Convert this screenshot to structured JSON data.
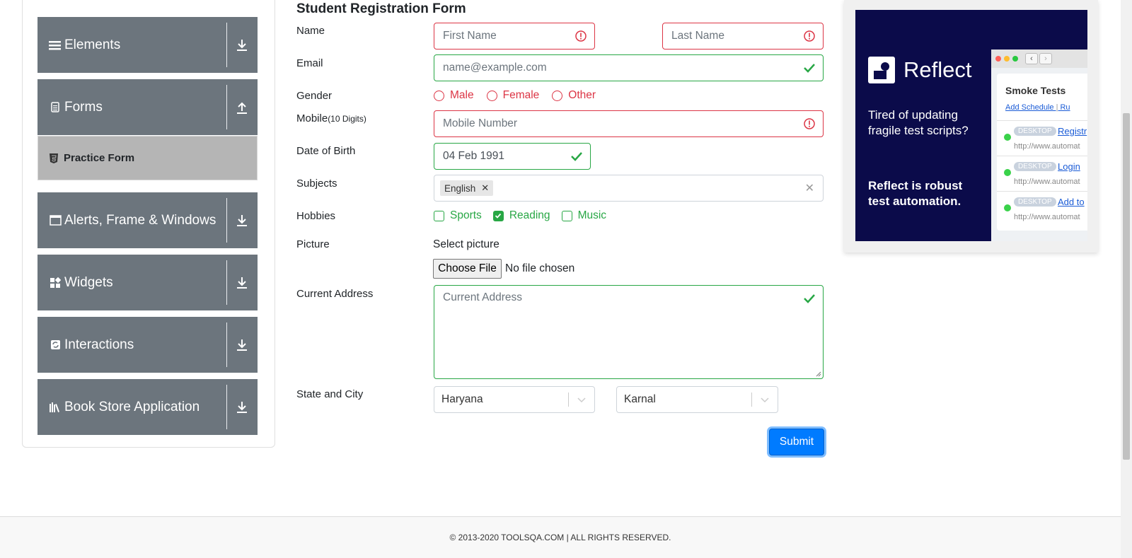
{
  "sidebar": {
    "groups": [
      {
        "label": "Elements",
        "icon": "hamburger-icon",
        "arrow": "download-icon"
      },
      {
        "label": "Forms",
        "icon": "document-icon",
        "arrow": "upload-icon"
      },
      {
        "label": "Alerts, Frame & Windows",
        "icon": "window-icon",
        "arrow": "download-icon"
      },
      {
        "label": "Widgets",
        "icon": "widgets-icon",
        "arrow": "download-icon"
      },
      {
        "label": "Interactions",
        "icon": "refresh-icon",
        "arrow": "download-icon"
      },
      {
        "label": "Book Store Application",
        "icon": "books-icon",
        "arrow": "download-icon"
      }
    ],
    "active_item": "Practice Form"
  },
  "form": {
    "title": "Student Registration Form",
    "labels": {
      "name": "Name",
      "email": "Email",
      "gender": "Gender",
      "mobile": "Mobile",
      "mobile_hint": "(10 Digits)",
      "dob": "Date of Birth",
      "subjects": "Subjects",
      "hobbies": "Hobbies",
      "picture": "Picture",
      "address": "Current Address",
      "state_city": "State and City"
    },
    "first_name": {
      "placeholder": "First Name",
      "value": ""
    },
    "last_name": {
      "placeholder": "Last Name",
      "value": ""
    },
    "email": {
      "placeholder": "name@example.com",
      "value": ""
    },
    "gender_options": [
      "Male",
      "Female",
      "Other"
    ],
    "mobile": {
      "placeholder": "Mobile Number",
      "value": ""
    },
    "dob": {
      "value": "04 Feb 1991"
    },
    "subjects": [
      "English"
    ],
    "hobbies": [
      {
        "label": "Sports",
        "checked": false
      },
      {
        "label": "Reading",
        "checked": true
      },
      {
        "label": "Music",
        "checked": false
      }
    ],
    "picture_label": "Select picture",
    "file_button": "Choose File",
    "file_status": "No file chosen",
    "address": {
      "placeholder": "Current Address",
      "value": ""
    },
    "state": "Haryana",
    "city": "Karnal",
    "submit": "Submit"
  },
  "ad": {
    "brand": "Reflect",
    "tagline1": "Tired of updating fragile test scripts?",
    "tagline2": "Reflect is robust test automation.",
    "panel_title": "Smoke Tests",
    "schedule_link": "Add Schedule",
    "run_link": "Ru",
    "rows": [
      {
        "tag": "DESKTOP",
        "link": "Registr",
        "url": "http://www.automat"
      },
      {
        "tag": "DESKTOP",
        "link": "Login",
        "url": "http://www.automat"
      },
      {
        "tag": "DESKTOP",
        "link": "Add to",
        "url": "http://www.automat"
      }
    ]
  },
  "footer": {
    "text": "© 2013-2020 TOOLSQA.COM | ALL RIGHTS RESERVED."
  },
  "colors": {
    "invalid": "#dc3545",
    "valid": "#28a745",
    "primary": "#007bff",
    "sidebar": "#6c757d",
    "ad_bg": "#0b0b4a"
  }
}
